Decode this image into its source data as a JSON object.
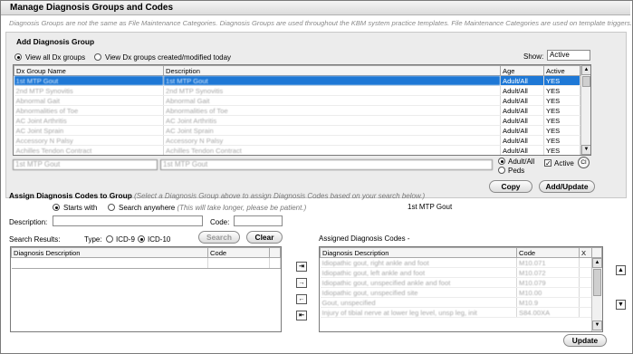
{
  "window": {
    "title": "Manage Diagnosis Groups and Codes",
    "subtitle": "Diagnosis Groups are not the same as File Maintenance Categories. Diagnosis Groups are used throughout the KBM system practice templates. File Maintenance Categories are used on template triggers."
  },
  "add_group": {
    "heading": "Add Diagnosis Group",
    "view_all_label": "View all Dx groups",
    "view_today_label": "View Dx groups created/modified today",
    "show_label": "Show:",
    "show_value": "Active",
    "columns": [
      "Dx Group Name",
      "Description",
      "Age",
      "Active"
    ],
    "rows": [
      [
        "1st MTP Gout",
        "1st MTP Gout",
        "Adult/All",
        "YES"
      ],
      [
        "2nd MTP Synovitis",
        "2nd MTP Synovitis",
        "Adult/All",
        "YES"
      ],
      [
        "Abnormal Gait",
        "Abnormal Gait",
        "Adult/All",
        "YES"
      ],
      [
        "Abnormalities of Toe",
        "Abnormalities of Toe",
        "Adult/All",
        "YES"
      ],
      [
        "AC Joint Arthritis",
        "AC Joint Arthritis",
        "Adult/All",
        "YES"
      ],
      [
        "AC Joint Sprain",
        "AC Joint Sprain",
        "Adult/All",
        "YES"
      ],
      [
        "Accessory N Palsy",
        "Accessory N Palsy",
        "Adult/All",
        "YES"
      ],
      [
        "Achilles Tendon Contract",
        "Achilles Tendon Contract",
        "Adult/All",
        "YES"
      ]
    ],
    "edit_name": "1st MTP Gout",
    "edit_description": "1st MTP Gout",
    "age_adult_label": "Adult/All",
    "age_peds_label": "Peds",
    "active_label": "Active",
    "clear_icon_label": "Cl",
    "copy_label": "Copy",
    "add_update_label": "Add/Update"
  },
  "assign": {
    "heading": "Assign Diagnosis Codes to Group",
    "hint": "(Select a Diagnosis Group above to assign Diagnosis Codes based on your search below.)",
    "starts_with_label": "Starts with",
    "search_anywhere_label": "Search anywhere",
    "search_anywhere_hint": "(This will take longer, please be patient.)",
    "selected_group": "1st MTP Gout",
    "description_label": "Description:",
    "description_value": "",
    "code_label": "Code:",
    "code_value": "",
    "search_results_label": "Search Results:",
    "type_label": "Type:",
    "icd9_label": "ICD-9",
    "icd10_label": "ICD-10",
    "search_label": "Search",
    "clear_label": "Clear",
    "results_columns": [
      "Diagnosis Description",
      "Code"
    ],
    "assigned_label": "Assigned Diagnosis Codes -",
    "assigned_columns": [
      "Diagnosis Description",
      "Code",
      "X"
    ],
    "assigned_rows": [
      [
        "Idiopathic gout, right ankle and foot",
        "M10.071"
      ],
      [
        "Idiopathic gout, left ankle and foot",
        "M10.072"
      ],
      [
        "Idiopathic gout, unspecified ankle and foot",
        "M10.079"
      ],
      [
        "Idiopathic gout, unspecified site",
        "M10.00"
      ],
      [
        "Gout, unspecified",
        "M10.9"
      ],
      [
        "Injury of tibial nerve at lower leg level, unsp leg, init",
        "S84.00XA"
      ]
    ],
    "update_label": "Update"
  },
  "icons": {
    "add_all": "double-right-arrow-icon",
    "add_one": "right-arrow-icon",
    "remove_one": "left-arrow-icon",
    "remove_all": "double-left-arrow-icon",
    "move_up": "up-arrow-icon",
    "move_down": "down-arrow-icon"
  },
  "colors": {
    "selection": "#1e78d6",
    "panel": "#ececec"
  }
}
